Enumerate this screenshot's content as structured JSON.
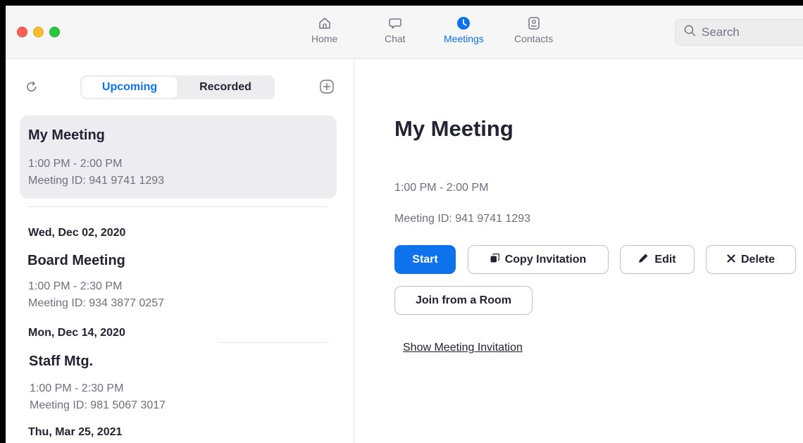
{
  "nav": {
    "tabs": [
      {
        "label": "Home",
        "icon": "home-icon"
      },
      {
        "label": "Chat",
        "icon": "chat-icon"
      },
      {
        "label": "Meetings",
        "icon": "meetings-clock-icon",
        "active": true
      },
      {
        "label": "Contacts",
        "icon": "contacts-icon"
      }
    ],
    "search_placeholder": "Search",
    "accent_color": "#0e72ed"
  },
  "sidebar": {
    "segments": [
      "Upcoming",
      "Recorded"
    ],
    "active_segment": "Upcoming",
    "meetings": [
      {
        "title": "My Meeting",
        "time": "1:00 PM - 2:00 PM",
        "id": "Meeting ID: 941 9741 1293",
        "selected": true
      },
      {
        "date": "Wed, Dec 02, 2020",
        "title": "Board Meeting",
        "time": "1:00 PM - 2:30 PM",
        "id": "Meeting ID: 934 3877 0257"
      },
      {
        "date": "Mon, Dec 14, 2020",
        "title": "Staff Mtg.",
        "time": "1:00 PM - 2:30 PM",
        "id": "Meeting ID: 981 5067 3017"
      },
      {
        "date": "Thu, Mar 25, 2021"
      }
    ]
  },
  "detail": {
    "title": "My Meeting",
    "time": "1:00 PM - 2:00 PM",
    "meeting_id": "Meeting ID: 941 9741 1293",
    "buttons": {
      "start": "Start",
      "copy_invitation": "Copy Invitation",
      "edit": "Edit",
      "delete": "Delete",
      "join_room": "Join from a Room"
    },
    "show_invitation_link": "Show Meeting Invitation"
  }
}
